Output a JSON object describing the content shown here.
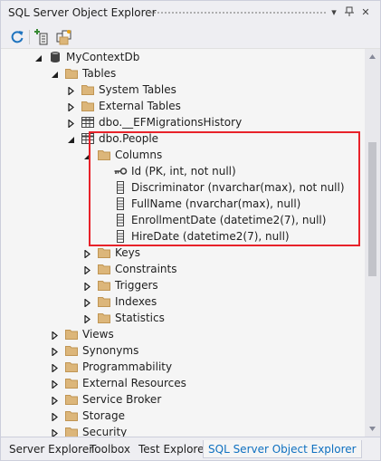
{
  "window": {
    "title": "SQL Server Object Explorer",
    "pin_glyph": "▾",
    "autohide_glyph": "—",
    "close_glyph": "✕"
  },
  "toolbar": {
    "refresh_icon": "refresh-icon",
    "add_sql_server_icon": "add-sql-server-icon",
    "show_all_icon": "show-all-files-icon"
  },
  "tree": {
    "nodes": [
      {
        "label": "MyContextDb",
        "icon": "database-icon",
        "expander": "expanded"
      },
      {
        "label": "Tables",
        "icon": "folder-icon",
        "expander": "expanded"
      },
      {
        "label": "System Tables",
        "icon": "folder-icon",
        "expander": "collapsed"
      },
      {
        "label": "External Tables",
        "icon": "folder-icon",
        "expander": "collapsed"
      },
      {
        "label": "dbo.__EFMigrationsHistory",
        "icon": "table-icon",
        "expander": "collapsed"
      },
      {
        "label": "dbo.People",
        "icon": "table-icon",
        "expander": "expanded"
      },
      {
        "label": "Columns",
        "icon": "folder-icon",
        "expander": "expanded"
      },
      {
        "label": "Id (PK, int, not null)",
        "icon": "primary-key-icon",
        "expander": "none"
      },
      {
        "label": "Discriminator (nvarchar(max), not null)",
        "icon": "column-icon",
        "expander": "none"
      },
      {
        "label": "FullName (nvarchar(max), null)",
        "icon": "column-icon",
        "expander": "none"
      },
      {
        "label": "EnrollmentDate (datetime2(7), null)",
        "icon": "column-icon",
        "expander": "none"
      },
      {
        "label": "HireDate (datetime2(7), null)",
        "icon": "column-icon",
        "expander": "none"
      },
      {
        "label": "Keys",
        "icon": "folder-icon",
        "expander": "collapsed"
      },
      {
        "label": "Constraints",
        "icon": "folder-icon",
        "expander": "collapsed"
      },
      {
        "label": "Triggers",
        "icon": "folder-icon",
        "expander": "collapsed"
      },
      {
        "label": "Indexes",
        "icon": "folder-icon",
        "expander": "collapsed"
      },
      {
        "label": "Statistics",
        "icon": "folder-icon",
        "expander": "collapsed"
      },
      {
        "label": "Views",
        "icon": "folder-icon",
        "expander": "collapsed"
      },
      {
        "label": "Synonyms",
        "icon": "folder-icon",
        "expander": "collapsed"
      },
      {
        "label": "Programmability",
        "icon": "folder-icon",
        "expander": "collapsed"
      },
      {
        "label": "External Resources",
        "icon": "folder-icon",
        "expander": "collapsed"
      },
      {
        "label": "Service Broker",
        "icon": "folder-icon",
        "expander": "collapsed"
      },
      {
        "label": "Storage",
        "icon": "folder-icon",
        "expander": "collapsed"
      },
      {
        "label": "Security",
        "icon": "folder-icon",
        "expander": "collapsed"
      }
    ]
  },
  "bottom_tabs": [
    {
      "label": "Server Explorer",
      "active": false
    },
    {
      "label": "Toolbox",
      "active": false
    },
    {
      "label": "Test Explorer",
      "active": false
    },
    {
      "label": "SQL Server Object Explorer",
      "active": true
    }
  ],
  "colors": {
    "folder": "#dcb67a",
    "folder_dark": "#c09553",
    "highlight_border": "#e8222a",
    "active_tab_text": "#0e70c0",
    "refresh": "#1e73be"
  }
}
